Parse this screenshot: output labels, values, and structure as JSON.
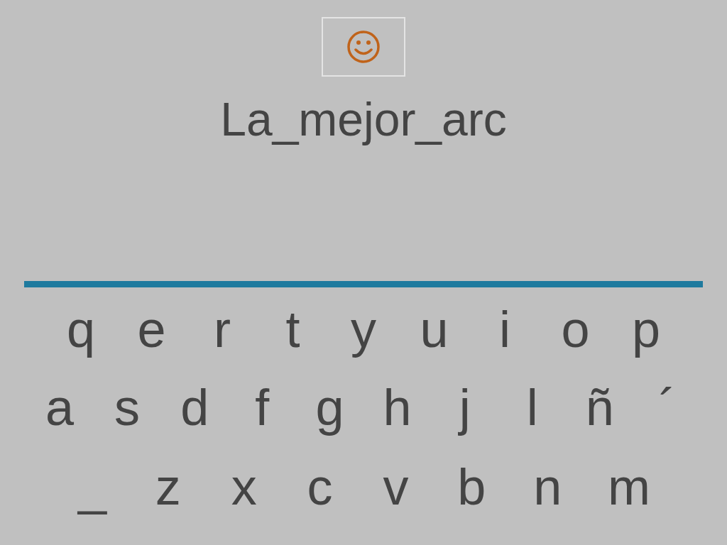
{
  "answer": {
    "text": "La_mejor_arc"
  },
  "keyboard": {
    "rows": [
      [
        "q",
        "e",
        "r",
        "t",
        "y",
        "u",
        "i",
        "o",
        "p"
      ],
      [
        "a",
        "s",
        "d",
        "f",
        "g",
        "h",
        "j",
        "l",
        "ñ",
        "´"
      ],
      [
        "_",
        "z",
        "x",
        "c",
        "v",
        "b",
        "n",
        "m"
      ]
    ]
  }
}
